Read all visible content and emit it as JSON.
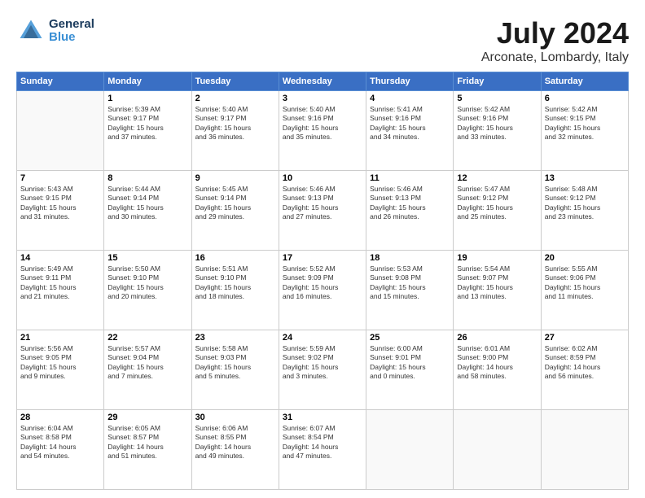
{
  "header": {
    "logo_general": "General",
    "logo_blue": "Blue",
    "title": "July 2024",
    "subtitle": "Arconate, Lombardy, Italy"
  },
  "calendar": {
    "days_of_week": [
      "Sunday",
      "Monday",
      "Tuesday",
      "Wednesday",
      "Thursday",
      "Friday",
      "Saturday"
    ],
    "weeks": [
      [
        {
          "day": "",
          "info": ""
        },
        {
          "day": "1",
          "info": "Sunrise: 5:39 AM\nSunset: 9:17 PM\nDaylight: 15 hours\nand 37 minutes."
        },
        {
          "day": "2",
          "info": "Sunrise: 5:40 AM\nSunset: 9:17 PM\nDaylight: 15 hours\nand 36 minutes."
        },
        {
          "day": "3",
          "info": "Sunrise: 5:40 AM\nSunset: 9:16 PM\nDaylight: 15 hours\nand 35 minutes."
        },
        {
          "day": "4",
          "info": "Sunrise: 5:41 AM\nSunset: 9:16 PM\nDaylight: 15 hours\nand 34 minutes."
        },
        {
          "day": "5",
          "info": "Sunrise: 5:42 AM\nSunset: 9:16 PM\nDaylight: 15 hours\nand 33 minutes."
        },
        {
          "day": "6",
          "info": "Sunrise: 5:42 AM\nSunset: 9:15 PM\nDaylight: 15 hours\nand 32 minutes."
        }
      ],
      [
        {
          "day": "7",
          "info": "Sunrise: 5:43 AM\nSunset: 9:15 PM\nDaylight: 15 hours\nand 31 minutes."
        },
        {
          "day": "8",
          "info": "Sunrise: 5:44 AM\nSunset: 9:14 PM\nDaylight: 15 hours\nand 30 minutes."
        },
        {
          "day": "9",
          "info": "Sunrise: 5:45 AM\nSunset: 9:14 PM\nDaylight: 15 hours\nand 29 minutes."
        },
        {
          "day": "10",
          "info": "Sunrise: 5:46 AM\nSunset: 9:13 PM\nDaylight: 15 hours\nand 27 minutes."
        },
        {
          "day": "11",
          "info": "Sunrise: 5:46 AM\nSunset: 9:13 PM\nDaylight: 15 hours\nand 26 minutes."
        },
        {
          "day": "12",
          "info": "Sunrise: 5:47 AM\nSunset: 9:12 PM\nDaylight: 15 hours\nand 25 minutes."
        },
        {
          "day": "13",
          "info": "Sunrise: 5:48 AM\nSunset: 9:12 PM\nDaylight: 15 hours\nand 23 minutes."
        }
      ],
      [
        {
          "day": "14",
          "info": "Sunrise: 5:49 AM\nSunset: 9:11 PM\nDaylight: 15 hours\nand 21 minutes."
        },
        {
          "day": "15",
          "info": "Sunrise: 5:50 AM\nSunset: 9:10 PM\nDaylight: 15 hours\nand 20 minutes."
        },
        {
          "day": "16",
          "info": "Sunrise: 5:51 AM\nSunset: 9:10 PM\nDaylight: 15 hours\nand 18 minutes."
        },
        {
          "day": "17",
          "info": "Sunrise: 5:52 AM\nSunset: 9:09 PM\nDaylight: 15 hours\nand 16 minutes."
        },
        {
          "day": "18",
          "info": "Sunrise: 5:53 AM\nSunset: 9:08 PM\nDaylight: 15 hours\nand 15 minutes."
        },
        {
          "day": "19",
          "info": "Sunrise: 5:54 AM\nSunset: 9:07 PM\nDaylight: 15 hours\nand 13 minutes."
        },
        {
          "day": "20",
          "info": "Sunrise: 5:55 AM\nSunset: 9:06 PM\nDaylight: 15 hours\nand 11 minutes."
        }
      ],
      [
        {
          "day": "21",
          "info": "Sunrise: 5:56 AM\nSunset: 9:05 PM\nDaylight: 15 hours\nand 9 minutes."
        },
        {
          "day": "22",
          "info": "Sunrise: 5:57 AM\nSunset: 9:04 PM\nDaylight: 15 hours\nand 7 minutes."
        },
        {
          "day": "23",
          "info": "Sunrise: 5:58 AM\nSunset: 9:03 PM\nDaylight: 15 hours\nand 5 minutes."
        },
        {
          "day": "24",
          "info": "Sunrise: 5:59 AM\nSunset: 9:02 PM\nDaylight: 15 hours\nand 3 minutes."
        },
        {
          "day": "25",
          "info": "Sunrise: 6:00 AM\nSunset: 9:01 PM\nDaylight: 15 hours\nand 0 minutes."
        },
        {
          "day": "26",
          "info": "Sunrise: 6:01 AM\nSunset: 9:00 PM\nDaylight: 14 hours\nand 58 minutes."
        },
        {
          "day": "27",
          "info": "Sunrise: 6:02 AM\nSunset: 8:59 PM\nDaylight: 14 hours\nand 56 minutes."
        }
      ],
      [
        {
          "day": "28",
          "info": "Sunrise: 6:04 AM\nSunset: 8:58 PM\nDaylight: 14 hours\nand 54 minutes."
        },
        {
          "day": "29",
          "info": "Sunrise: 6:05 AM\nSunset: 8:57 PM\nDaylight: 14 hours\nand 51 minutes."
        },
        {
          "day": "30",
          "info": "Sunrise: 6:06 AM\nSunset: 8:55 PM\nDaylight: 14 hours\nand 49 minutes."
        },
        {
          "day": "31",
          "info": "Sunrise: 6:07 AM\nSunset: 8:54 PM\nDaylight: 14 hours\nand 47 minutes."
        },
        {
          "day": "",
          "info": ""
        },
        {
          "day": "",
          "info": ""
        },
        {
          "day": "",
          "info": ""
        }
      ]
    ]
  }
}
